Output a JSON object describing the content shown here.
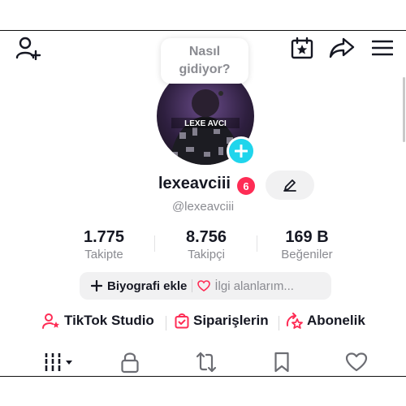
{
  "header": {
    "add_friend_icon": "person-plus-icon",
    "calendar_icon": "calendar-star-icon",
    "share_icon": "share-arrow-icon",
    "menu_icon": "hamburger-menu-icon"
  },
  "tooltip": {
    "text": "Nasıl\ngidiyor?"
  },
  "profile": {
    "avatar_text": "LEXE AVCI",
    "username": "lexeavciii",
    "notification_count": "6",
    "handle": "@lexeavciii"
  },
  "stats": [
    {
      "value": "1.775",
      "label": "Takipte"
    },
    {
      "value": "8.756",
      "label": "Takipçi"
    },
    {
      "value": "169 B",
      "label": "Beğeniler"
    }
  ],
  "bio_bar": {
    "add_bio_label": "Biyografi ekle",
    "interests_label": "İlgi alanlarım..."
  },
  "links": [
    {
      "label": "TikTok Studio",
      "icon": "person-star-icon"
    },
    {
      "label": "Siparişlerin",
      "icon": "shopping-bag-check-icon"
    },
    {
      "label": "Abonelik",
      "icon": "subscription-star-icon"
    }
  ],
  "colors": {
    "accent": "#fe2c55",
    "plus_badge": "#20d5ec",
    "muted": "#8a8b91"
  },
  "tabs": [
    "grid-icon",
    "lock-icon",
    "repost-icon",
    "bookmark-icon",
    "heart-icon"
  ]
}
